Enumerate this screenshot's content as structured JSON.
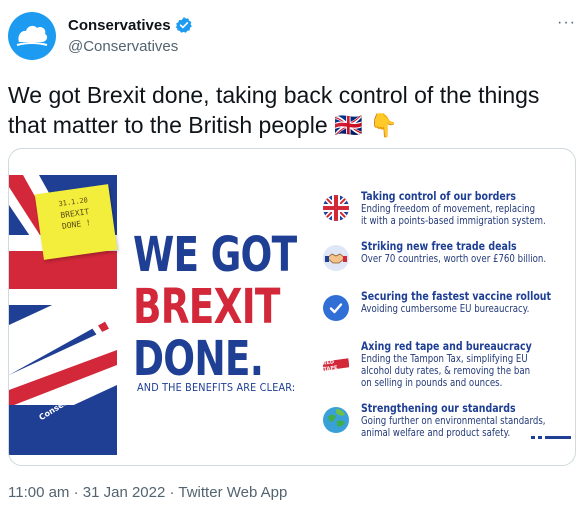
{
  "tweet": {
    "display_name": "Conservatives",
    "handle": "@Conservatives",
    "more_label": "···",
    "text": "We got Brexit done, taking back control of the things that matter to the British people 🇬🇧 👇",
    "timestamp": "11:00 am · 31 Jan 2022 · Twitter Web App"
  },
  "poster": {
    "sticky_note": {
      "line1": "31.1.20",
      "line2": "BREXIT",
      "line3": "DONE !"
    },
    "brand_label": "Conservatives",
    "headline": [
      "WE GOT",
      "BREXIT",
      "DONE."
    ],
    "subline": "AND THE BENEFITS ARE CLEAR:",
    "benefits": [
      {
        "icon": "uk-flag-icon",
        "title": "Taking control of our borders",
        "desc": [
          "Ending freedom of movement, replacing",
          "it with a points-based immigration system."
        ]
      },
      {
        "icon": "handshake-icon",
        "title": "Striking new free trade deals",
        "desc": [
          "Over 70 countries, worth over £760 billion."
        ]
      },
      {
        "icon": "check-icon",
        "title": "Securing the fastest vaccine rollout",
        "desc": [
          "Avoiding cumbersome EU bureaucracy."
        ]
      },
      {
        "icon": "red-tape-icon",
        "icon_text": "RED TAPE",
        "title": "Axing red tape and bureaucracy",
        "desc": [
          "Ending the Tampon Tax, simplifying EU",
          "alcohol duty rates, & removing the ban",
          "on selling in pounds and ounces."
        ]
      },
      {
        "icon": "globe-leaf-icon",
        "title": "Strengthening our standards",
        "desc": [
          "Going further on environmental standards,",
          "animal welfare and product safety."
        ]
      }
    ]
  },
  "colors": {
    "accent_blue": "#1f3f95",
    "accent_red": "#d2283a",
    "twitter_blue": "#1d9bf0",
    "note_yellow": "#f3ee3b"
  }
}
